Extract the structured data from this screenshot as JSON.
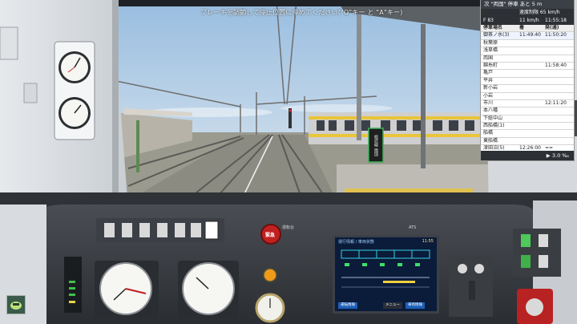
{
  "hint": "ブレーキを調節して停止位置に停めてください(\"Q\"キー と \"A\"キー)",
  "timetable": {
    "header_next": "次 \"両国\" 停車 あと 5 m",
    "speed_limit": "速度制限 65 km/h",
    "info_id": "F 83",
    "info_speed": "11 km/h",
    "info_time": "11:55:18",
    "col_station": "停車場名",
    "col_arrive": "着",
    "col_depart": "発(通)",
    "rows": [
      {
        "station": "御茶ノ水(3)",
        "arrive": "11:49:40",
        "depart": "11:50:20"
      },
      {
        "station": "秋葉原",
        "arrive": "",
        "depart": ""
      },
      {
        "station": "浅草橋",
        "arrive": "",
        "depart": ""
      },
      {
        "station": "両国",
        "arrive": "",
        "depart": ""
      },
      {
        "station": "錦糸町",
        "arrive": "",
        "depart": "11:58:40"
      },
      {
        "station": "亀戸",
        "arrive": "",
        "depart": ""
      },
      {
        "station": "平井",
        "arrive": "",
        "depart": ""
      },
      {
        "station": "新小岩",
        "arrive": "",
        "depart": ""
      },
      {
        "station": "小岩",
        "arrive": "",
        "depart": ""
      },
      {
        "station": "市川",
        "arrive": "",
        "depart": "12:11:20"
      },
      {
        "station": "本八幡",
        "arrive": "",
        "depart": ""
      },
      {
        "station": "下総中山",
        "arrive": "",
        "depart": ""
      },
      {
        "station": "西船橋(1)",
        "arrive": "",
        "depart": ""
      },
      {
        "station": "船橋",
        "arrive": "",
        "depart": ""
      },
      {
        "station": "東船橋",
        "arrive": "",
        "depart": ""
      },
      {
        "station": "津田沼(5)",
        "arrive": "12:26:00",
        "depart": "=="
      }
    ],
    "footer": "▶ 3.0 ‰"
  },
  "station_sign": "総武線 両国",
  "emergency_label": "緊急",
  "monitor": {
    "title": "運行情報 / 車両状態",
    "time": "11:55",
    "btn_left": "運転情報",
    "btn_mid": "車両情報",
    "btn_right": "メニュー"
  },
  "panel_labels": {
    "pa": "運転台",
    "ats": "ATS"
  },
  "colors": {
    "sky_top": "#a9c6e4",
    "sky_bottom": "#d9e4ee",
    "cab_dark": "#2c2f34",
    "train_yellow": "#e8c53a"
  }
}
